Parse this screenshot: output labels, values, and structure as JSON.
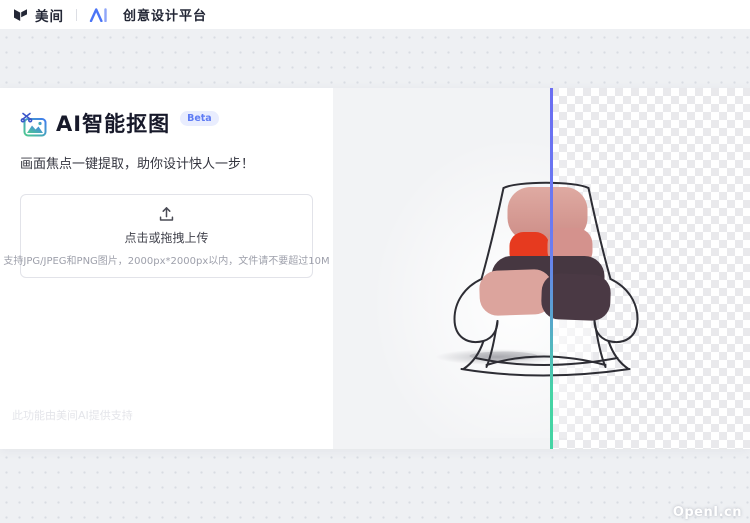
{
  "navbar": {
    "brand": "美间",
    "divider": "|",
    "platform": "创意设计平台"
  },
  "panel": {
    "title": "AI智能抠图",
    "badge": "Beta",
    "subtitle": "画面焦点一键提取，助你设计快人一步！",
    "upload": {
      "main_text": "点击或拖拽上传",
      "hint_text": "支持JPG/JPEG和PNG图片，2000px*2000px以内，文件请不要超过10M"
    },
    "footer_note": "此功能由美间AI提供支持"
  },
  "preview": {
    "demo_image": "lounge-chair-cutout-demo",
    "left_side": "original-photo",
    "right_side": "transparent-checkerboard"
  },
  "watermark": "OpenI.cn",
  "colors": {
    "brand_dark": "#232736",
    "ai_blue": "#4b74f6",
    "accent_gradient_top": "#6a6df2",
    "accent_gradient_bottom": "#45d4a4",
    "badge_bg": "#e9edfe",
    "badge_text": "#5e7bf4",
    "icon_gradient_start": "#4fca90",
    "icon_gradient_end": "#3f7bf0"
  }
}
